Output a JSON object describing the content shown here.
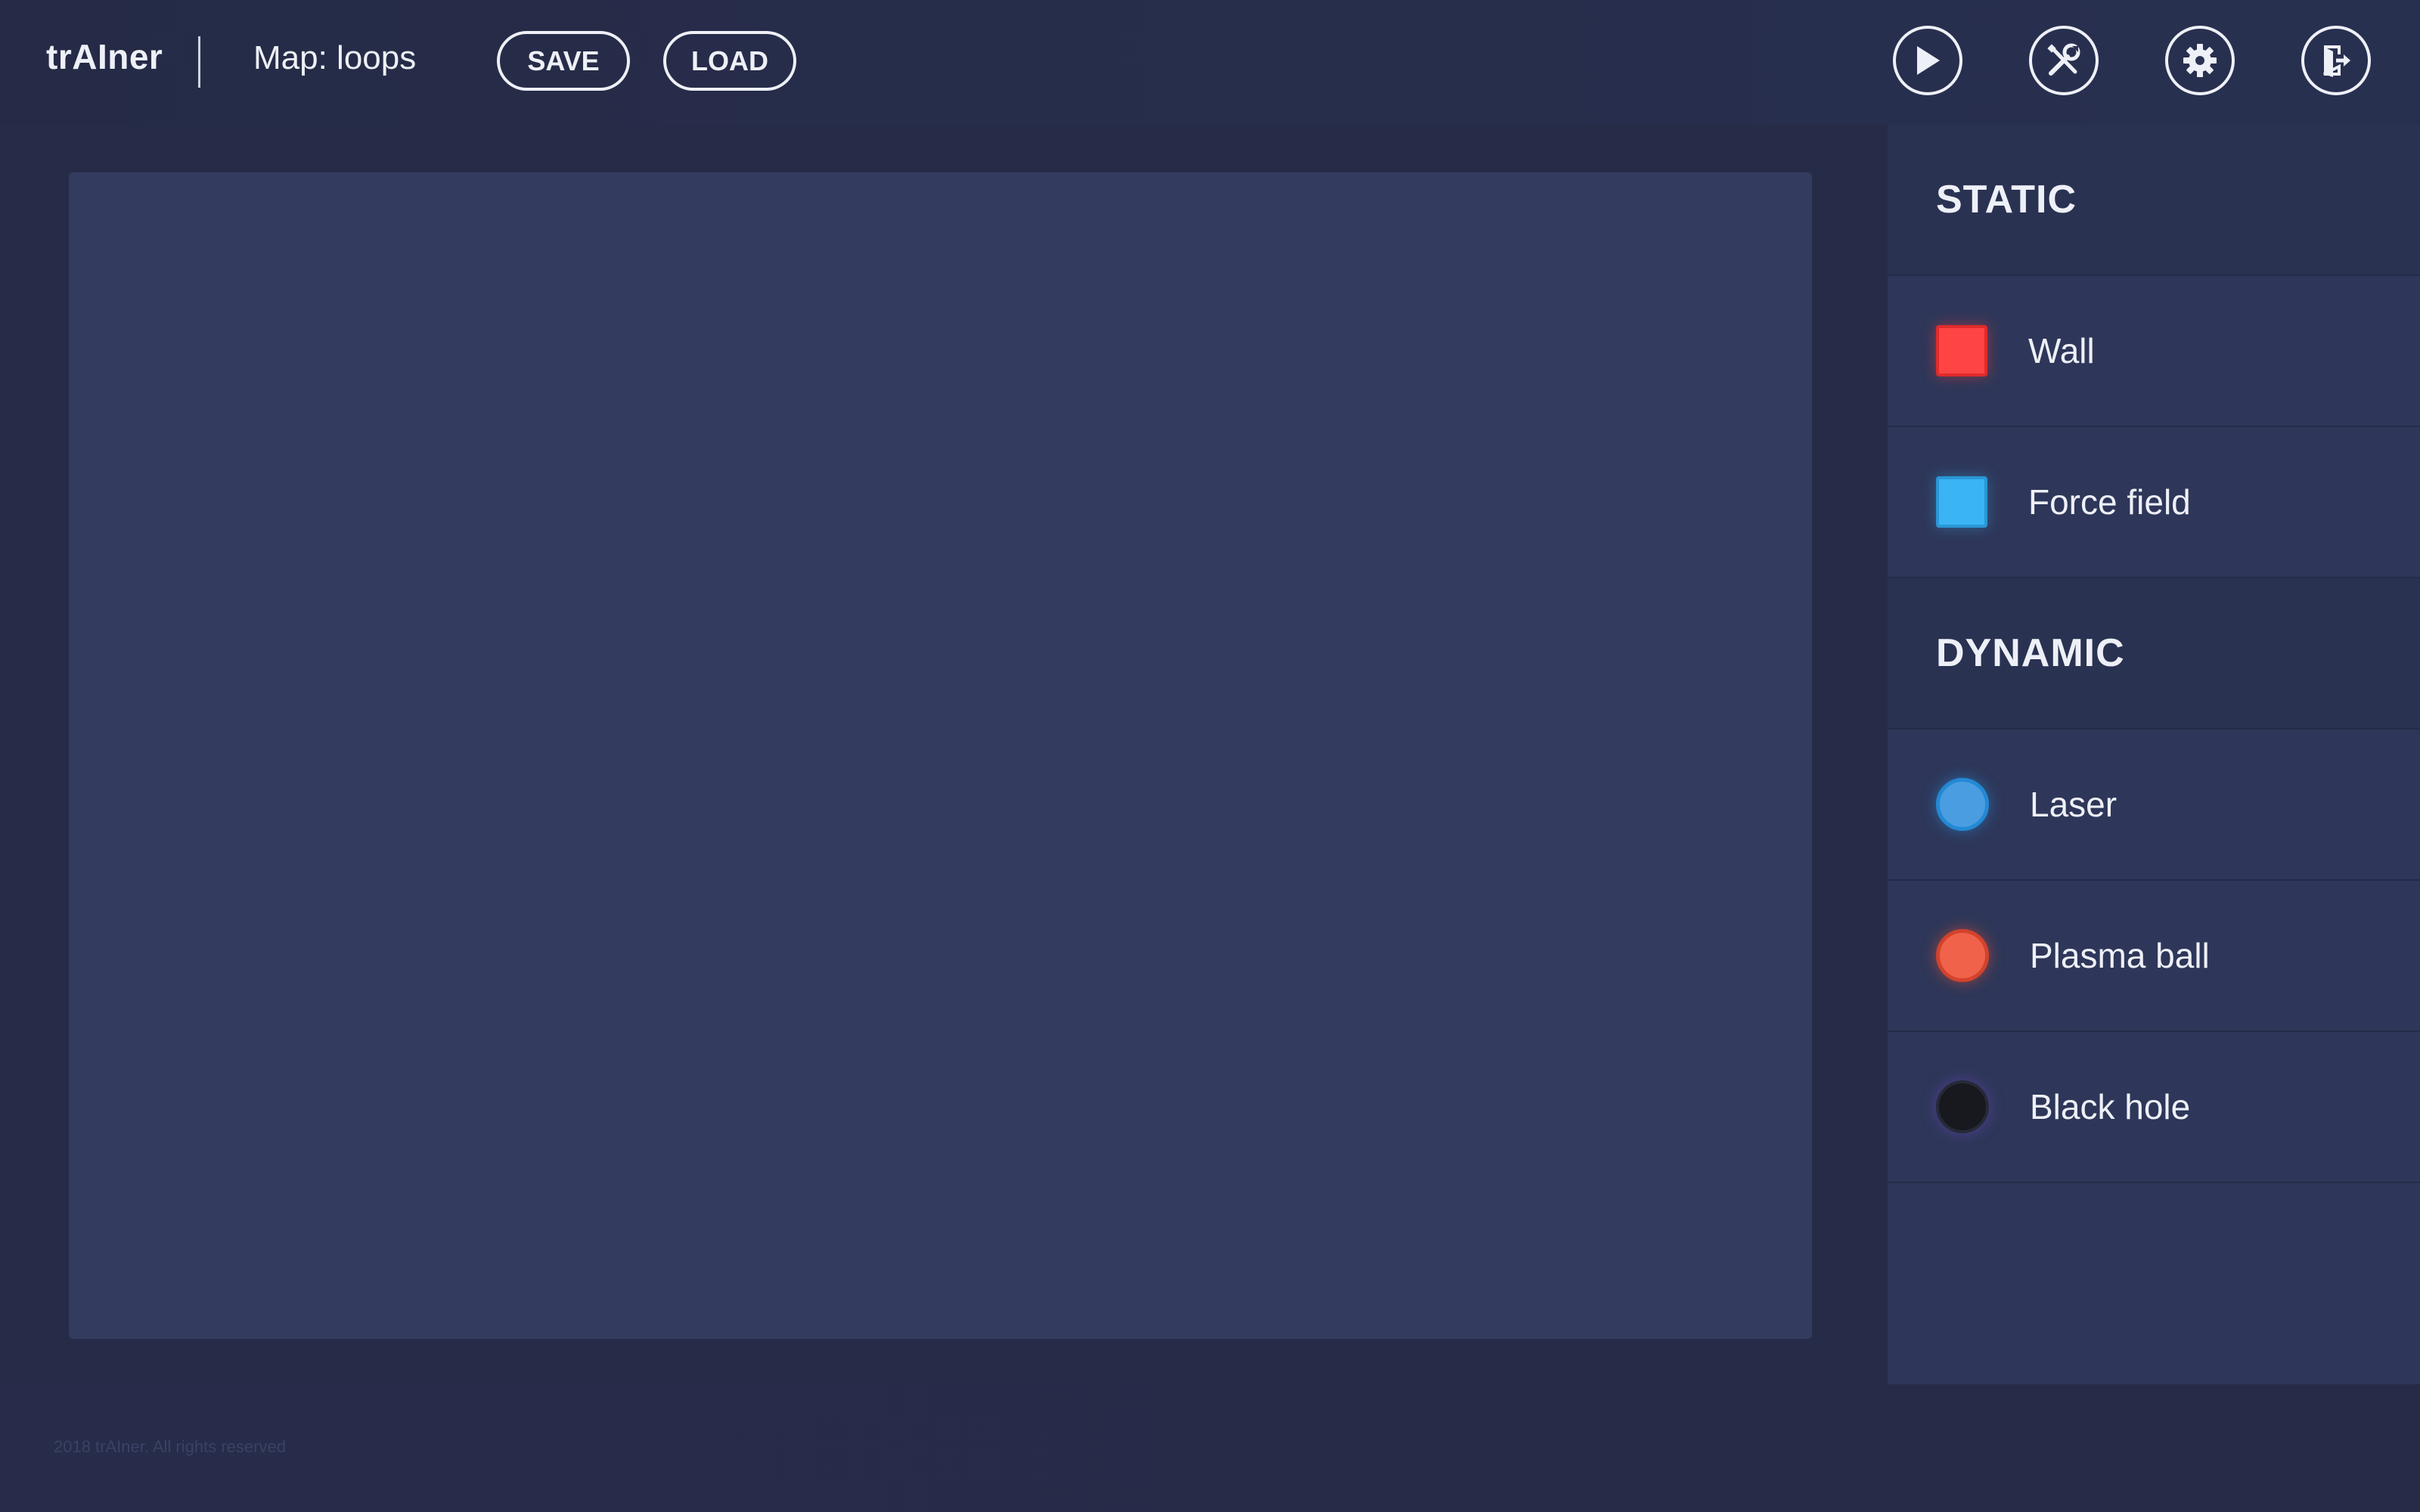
{
  "header": {
    "brand": "trAIner",
    "map_title": "Map: loops",
    "save_label": "SAVE",
    "load_label": "LOAD",
    "icons": [
      "play-icon",
      "tools-icon",
      "gear-icon",
      "exit-icon"
    ]
  },
  "sidebar": {
    "static_title": "STATIC",
    "static_items": [
      {
        "label": "Wall",
        "icon": "wall-swatch",
        "color": "#ff4444"
      },
      {
        "label": "Force field",
        "icon": "force-field-swatch",
        "color": "#3ab4f5"
      }
    ],
    "dynamic_title": "DYNAMIC",
    "dynamic_items": [
      {
        "label": "Laser",
        "icon": "laser-swatch",
        "color": "#4a9de0"
      },
      {
        "label": "Plasma ball",
        "icon": "plasma-ball-swatch",
        "color": "#f0634a"
      },
      {
        "label": "Black hole",
        "icon": "black-hole-swatch",
        "color": "#17191f"
      }
    ]
  },
  "footer": {
    "copyright": "2018 trAIner. All rights reserved"
  },
  "colors": {
    "background": "#242a45",
    "canvas": "#333c5e",
    "sidebar": "#2e3759",
    "text": "#eef0f7"
  }
}
